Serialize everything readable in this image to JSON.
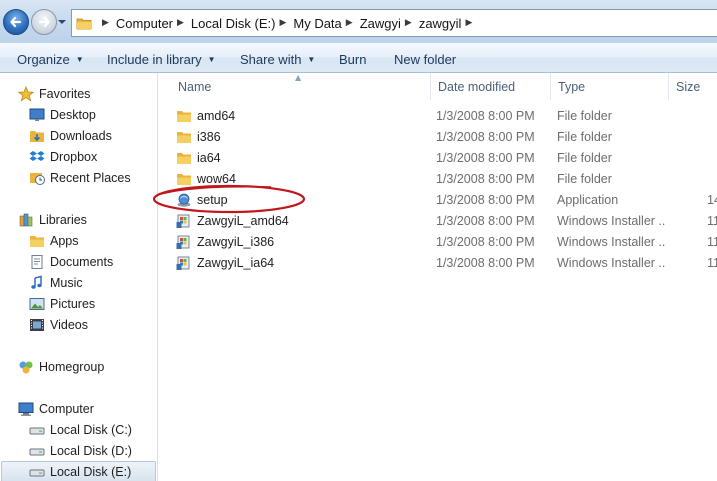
{
  "address_bar": {
    "breadcrumbs": [
      "Computer",
      "Local Disk (E:)",
      "My Data",
      "Zawgyi",
      "zawgyil"
    ]
  },
  "toolbar": {
    "organize": "Organize",
    "include_in_library": "Include in library",
    "share_with": "Share with",
    "burn": "Burn",
    "new_folder": "New folder"
  },
  "navigation": {
    "favorites": {
      "label": "Favorites",
      "items": [
        {
          "label": "Desktop",
          "icon": "desktop-icon"
        },
        {
          "label": "Downloads",
          "icon": "downloads-folder-icon"
        },
        {
          "label": "Dropbox",
          "icon": "dropbox-icon"
        },
        {
          "label": "Recent Places",
          "icon": "recent-places-icon"
        }
      ]
    },
    "libraries": {
      "label": "Libraries",
      "items": [
        {
          "label": "Apps",
          "icon": "folder-icon"
        },
        {
          "label": "Documents",
          "icon": "documents-icon"
        },
        {
          "label": "Music",
          "icon": "music-icon"
        },
        {
          "label": "Pictures",
          "icon": "pictures-icon"
        },
        {
          "label": "Videos",
          "icon": "videos-icon"
        }
      ]
    },
    "homegroup": {
      "label": "Homegroup"
    },
    "computer": {
      "label": "Computer",
      "items": [
        {
          "label": "Local Disk (C:)",
          "icon": "drive-icon"
        },
        {
          "label": "Local Disk (D:)",
          "icon": "drive-icon"
        },
        {
          "label": "Local Disk (E:)",
          "icon": "drive-icon",
          "selected": true
        }
      ]
    }
  },
  "file_list": {
    "columns": {
      "name": "Name",
      "date_modified": "Date modified",
      "type": "Type",
      "size": "Size"
    },
    "rows": [
      {
        "name": "amd64",
        "date": "1/3/2008 8:00 PM",
        "type": "File folder",
        "size": "",
        "icon": "folder-icon"
      },
      {
        "name": "i386",
        "date": "1/3/2008 8:00 PM",
        "type": "File folder",
        "size": "",
        "icon": "folder-icon"
      },
      {
        "name": "ia64",
        "date": "1/3/2008 8:00 PM",
        "type": "File folder",
        "size": "",
        "icon": "folder-icon"
      },
      {
        "name": "wow64",
        "date": "1/3/2008 8:00 PM",
        "type": "File folder",
        "size": "",
        "icon": "folder-icon"
      },
      {
        "name": "setup",
        "date": "1/3/2008 8:00 PM",
        "type": "Application",
        "size": "14",
        "icon": "setup-application-icon"
      },
      {
        "name": "ZawgyiL_amd64",
        "date": "1/3/2008 8:00 PM",
        "type": "Windows Installer ...",
        "size": "11",
        "icon": "windows-installer-icon"
      },
      {
        "name": "ZawgyiL_i386",
        "date": "1/3/2008 8:00 PM",
        "type": "Windows Installer ...",
        "size": "11",
        "icon": "windows-installer-icon"
      },
      {
        "name": "ZawgyiL_ia64",
        "date": "1/3/2008 8:00 PM",
        "type": "Windows Installer ...",
        "size": "11",
        "icon": "windows-installer-icon"
      }
    ]
  },
  "colors": {
    "highlight_ellipse": "#c0161c",
    "folder": "#e8b43c",
    "toolbar_text": "#1e395b"
  }
}
